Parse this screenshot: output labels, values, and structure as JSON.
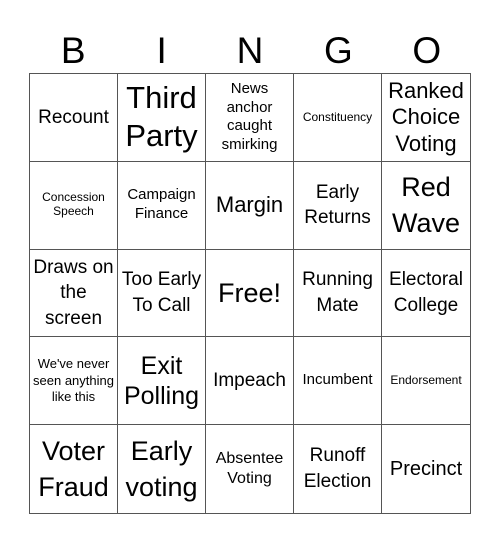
{
  "header": {
    "letters": [
      "B",
      "I",
      "N",
      "G",
      "O"
    ]
  },
  "cells": [
    [
      "Recount",
      "Third Party",
      "News anchor caught smirking",
      "Constituency",
      "Ranked Choice Voting"
    ],
    [
      "Concession Speech",
      "Campaign Finance",
      "Margin",
      "Early Returns",
      "Red Wave"
    ],
    [
      "Draws on the screen",
      "Too Early To Call",
      "Free!",
      "Running Mate",
      "Electoral College"
    ],
    [
      "We've never seen anything like this",
      "Exit Polling",
      "Impeach",
      "Incumbent",
      "Endorsement"
    ],
    [
      "Voter Fraud",
      "Early voting",
      "Absentee Voting",
      "Runoff Election",
      "Precinct"
    ]
  ]
}
